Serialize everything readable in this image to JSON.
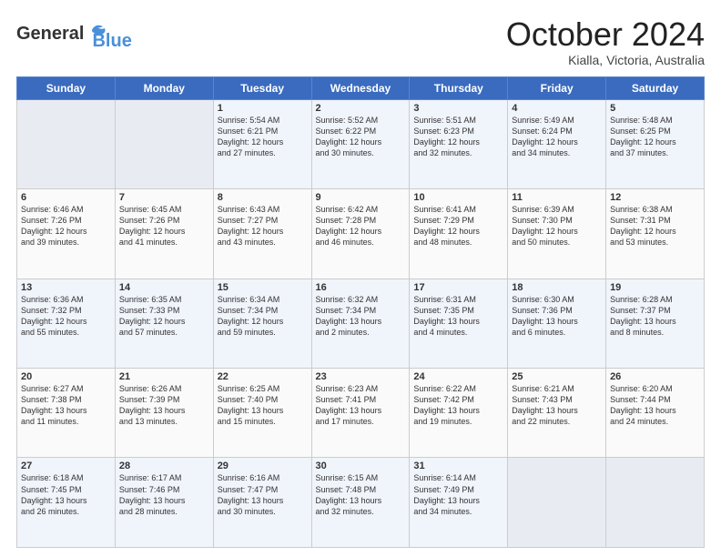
{
  "header": {
    "logo_line1": "General",
    "logo_line2": "Blue",
    "month": "October 2024",
    "location": "Kialla, Victoria, Australia"
  },
  "weekdays": [
    "Sunday",
    "Monday",
    "Tuesday",
    "Wednesday",
    "Thursday",
    "Friday",
    "Saturday"
  ],
  "weeks": [
    [
      {
        "day": "",
        "info": ""
      },
      {
        "day": "",
        "info": ""
      },
      {
        "day": "1",
        "info": "Sunrise: 5:54 AM\nSunset: 6:21 PM\nDaylight: 12 hours\nand 27 minutes."
      },
      {
        "day": "2",
        "info": "Sunrise: 5:52 AM\nSunset: 6:22 PM\nDaylight: 12 hours\nand 30 minutes."
      },
      {
        "day": "3",
        "info": "Sunrise: 5:51 AM\nSunset: 6:23 PM\nDaylight: 12 hours\nand 32 minutes."
      },
      {
        "day": "4",
        "info": "Sunrise: 5:49 AM\nSunset: 6:24 PM\nDaylight: 12 hours\nand 34 minutes."
      },
      {
        "day": "5",
        "info": "Sunrise: 5:48 AM\nSunset: 6:25 PM\nDaylight: 12 hours\nand 37 minutes."
      }
    ],
    [
      {
        "day": "6",
        "info": "Sunrise: 6:46 AM\nSunset: 7:26 PM\nDaylight: 12 hours\nand 39 minutes."
      },
      {
        "day": "7",
        "info": "Sunrise: 6:45 AM\nSunset: 7:26 PM\nDaylight: 12 hours\nand 41 minutes."
      },
      {
        "day": "8",
        "info": "Sunrise: 6:43 AM\nSunset: 7:27 PM\nDaylight: 12 hours\nand 43 minutes."
      },
      {
        "day": "9",
        "info": "Sunrise: 6:42 AM\nSunset: 7:28 PM\nDaylight: 12 hours\nand 46 minutes."
      },
      {
        "day": "10",
        "info": "Sunrise: 6:41 AM\nSunset: 7:29 PM\nDaylight: 12 hours\nand 48 minutes."
      },
      {
        "day": "11",
        "info": "Sunrise: 6:39 AM\nSunset: 7:30 PM\nDaylight: 12 hours\nand 50 minutes."
      },
      {
        "day": "12",
        "info": "Sunrise: 6:38 AM\nSunset: 7:31 PM\nDaylight: 12 hours\nand 53 minutes."
      }
    ],
    [
      {
        "day": "13",
        "info": "Sunrise: 6:36 AM\nSunset: 7:32 PM\nDaylight: 12 hours\nand 55 minutes."
      },
      {
        "day": "14",
        "info": "Sunrise: 6:35 AM\nSunset: 7:33 PM\nDaylight: 12 hours\nand 57 minutes."
      },
      {
        "day": "15",
        "info": "Sunrise: 6:34 AM\nSunset: 7:34 PM\nDaylight: 12 hours\nand 59 minutes."
      },
      {
        "day": "16",
        "info": "Sunrise: 6:32 AM\nSunset: 7:34 PM\nDaylight: 13 hours\nand 2 minutes."
      },
      {
        "day": "17",
        "info": "Sunrise: 6:31 AM\nSunset: 7:35 PM\nDaylight: 13 hours\nand 4 minutes."
      },
      {
        "day": "18",
        "info": "Sunrise: 6:30 AM\nSunset: 7:36 PM\nDaylight: 13 hours\nand 6 minutes."
      },
      {
        "day": "19",
        "info": "Sunrise: 6:28 AM\nSunset: 7:37 PM\nDaylight: 13 hours\nand 8 minutes."
      }
    ],
    [
      {
        "day": "20",
        "info": "Sunrise: 6:27 AM\nSunset: 7:38 PM\nDaylight: 13 hours\nand 11 minutes."
      },
      {
        "day": "21",
        "info": "Sunrise: 6:26 AM\nSunset: 7:39 PM\nDaylight: 13 hours\nand 13 minutes."
      },
      {
        "day": "22",
        "info": "Sunrise: 6:25 AM\nSunset: 7:40 PM\nDaylight: 13 hours\nand 15 minutes."
      },
      {
        "day": "23",
        "info": "Sunrise: 6:23 AM\nSunset: 7:41 PM\nDaylight: 13 hours\nand 17 minutes."
      },
      {
        "day": "24",
        "info": "Sunrise: 6:22 AM\nSunset: 7:42 PM\nDaylight: 13 hours\nand 19 minutes."
      },
      {
        "day": "25",
        "info": "Sunrise: 6:21 AM\nSunset: 7:43 PM\nDaylight: 13 hours\nand 22 minutes."
      },
      {
        "day": "26",
        "info": "Sunrise: 6:20 AM\nSunset: 7:44 PM\nDaylight: 13 hours\nand 24 minutes."
      }
    ],
    [
      {
        "day": "27",
        "info": "Sunrise: 6:18 AM\nSunset: 7:45 PM\nDaylight: 13 hours\nand 26 minutes."
      },
      {
        "day": "28",
        "info": "Sunrise: 6:17 AM\nSunset: 7:46 PM\nDaylight: 13 hours\nand 28 minutes."
      },
      {
        "day": "29",
        "info": "Sunrise: 6:16 AM\nSunset: 7:47 PM\nDaylight: 13 hours\nand 30 minutes."
      },
      {
        "day": "30",
        "info": "Sunrise: 6:15 AM\nSunset: 7:48 PM\nDaylight: 13 hours\nand 32 minutes."
      },
      {
        "day": "31",
        "info": "Sunrise: 6:14 AM\nSunset: 7:49 PM\nDaylight: 13 hours\nand 34 minutes."
      },
      {
        "day": "",
        "info": ""
      },
      {
        "day": "",
        "info": ""
      }
    ]
  ]
}
